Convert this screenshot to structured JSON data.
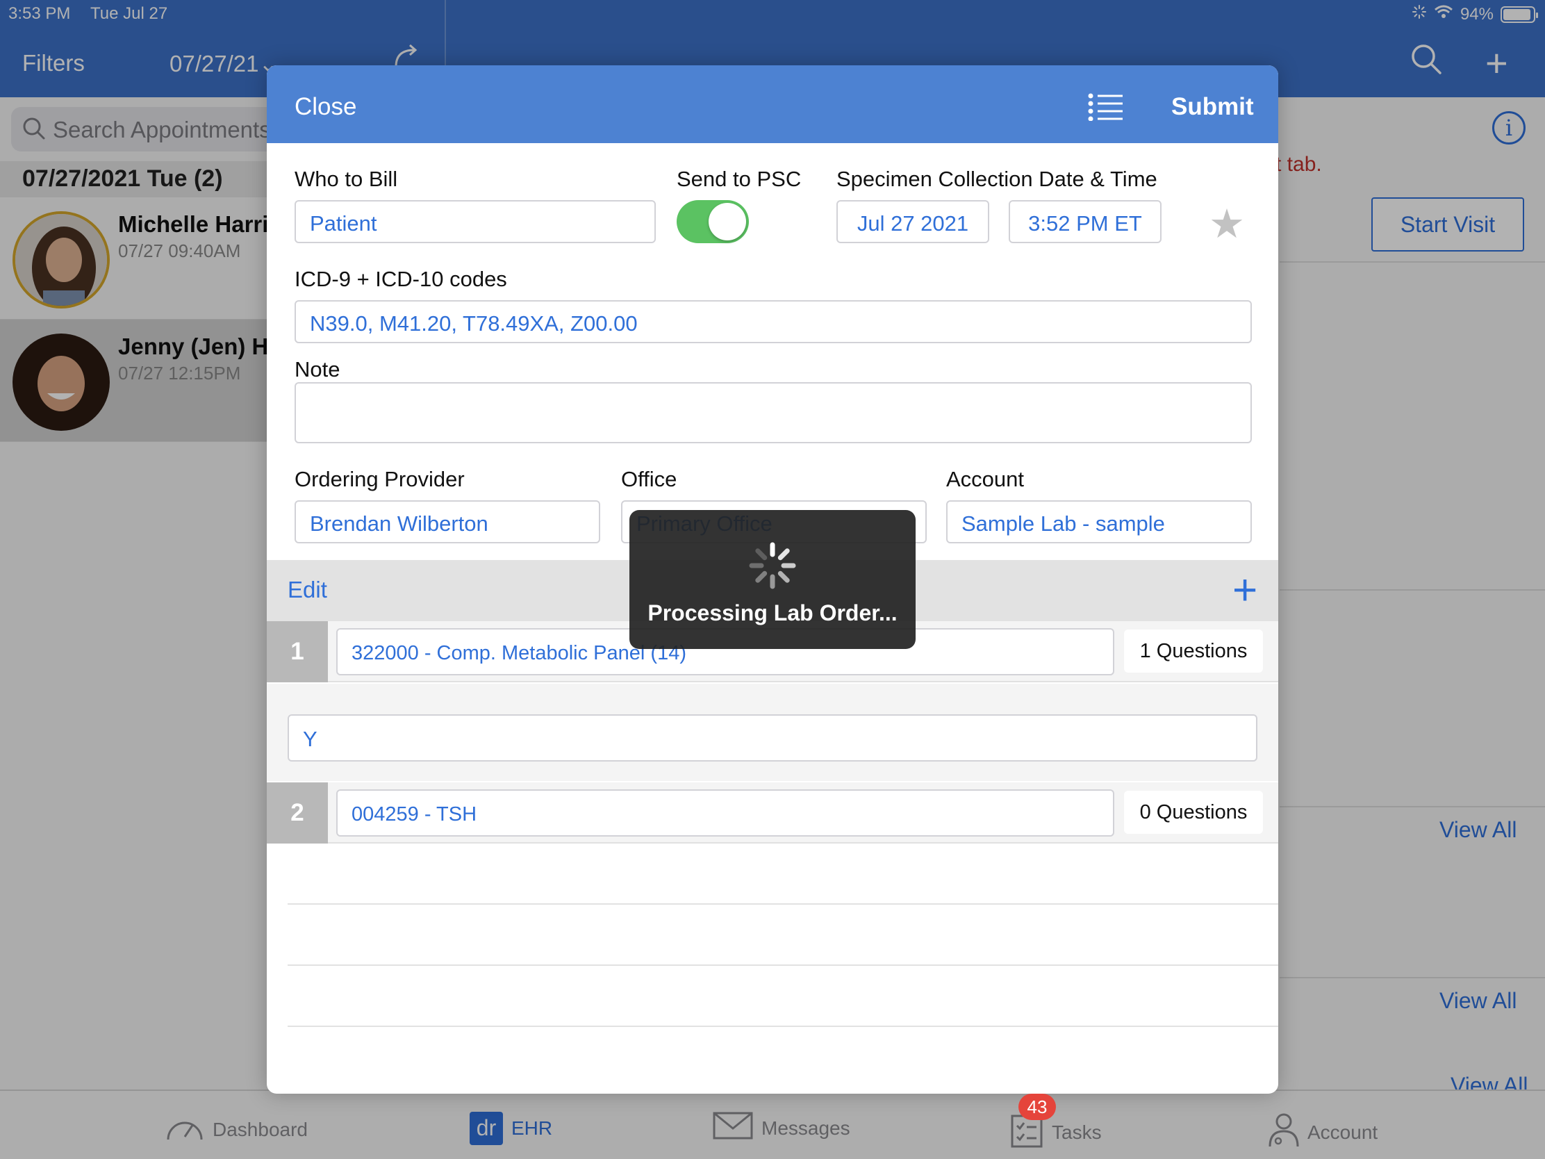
{
  "status_bar": {
    "time": "3:53 PM",
    "date": "Tue Jul 27",
    "battery": "94%",
    "battery_level": 0.94
  },
  "toolbar": {
    "filters_label": "Filters",
    "date_selector": "07/27/21⌄"
  },
  "left_pane": {
    "search_placeholder": "Search Appointments",
    "date_header": "07/27/2021 Tue (2)",
    "appointments": [
      {
        "name": "Michelle Harris",
        "time": "07/27 09:40AM",
        "selected": false
      },
      {
        "name": "Jenny (Jen) Harris",
        "time": "07/27 12:15PM",
        "selected": true
      }
    ]
  },
  "right_pane": {
    "note_fragment": "t tab.",
    "start_visit_label": "Start Visit",
    "view_all_labels": [
      "View All",
      "View All",
      "View All"
    ]
  },
  "modal": {
    "close_label": "Close",
    "submit_label": "Submit",
    "who_to_bill_label": "Who to Bill",
    "who_to_bill_value": "Patient",
    "send_to_psc_label": "Send to PSC",
    "send_to_psc_on": true,
    "specimen_label": "Specimen Collection Date & Time",
    "specimen_date": "Jul 27 2021",
    "specimen_time": "3:52 PM ET",
    "icd_label": "ICD-9 + ICD-10 codes",
    "icd_value": "N39.0, M41.20, T78.49XA, Z00.00",
    "note_label": "Note",
    "note_value": "",
    "ordering_provider_label": "Ordering Provider",
    "ordering_provider_value": "Brendan Wilberton",
    "office_label": "Office",
    "office_value": "Primary Office",
    "account_label": "Account",
    "account_value": "Sample Lab - sample",
    "edit_label": "Edit",
    "tests": [
      {
        "number": "1",
        "name": "322000 - Comp. Metabolic Panel (14)",
        "questions": "1 Questions"
      },
      {
        "number": "2",
        "name": "004259 - TSH",
        "questions": "0 Questions"
      }
    ],
    "answer_value": "Y"
  },
  "hud": {
    "message": "Processing Lab Order..."
  },
  "tab_bar": {
    "items": [
      {
        "label": "Dashboard",
        "icon": "gauge-icon"
      },
      {
        "label": "EHR",
        "icon": "dr-logo-icon",
        "logo_text": "dr",
        "active": true
      },
      {
        "label": "Messages",
        "icon": "envelope-icon"
      },
      {
        "label": "Tasks",
        "icon": "checklist-icon",
        "badge": "43"
      },
      {
        "label": "Account",
        "icon": "doctor-icon"
      }
    ]
  },
  "colors": {
    "accent": "#2f6fd8",
    "header": "#3d72c9",
    "modal_header": "#4d82d2",
    "toggle_on": "#5bc262",
    "badge": "#e5443b"
  }
}
